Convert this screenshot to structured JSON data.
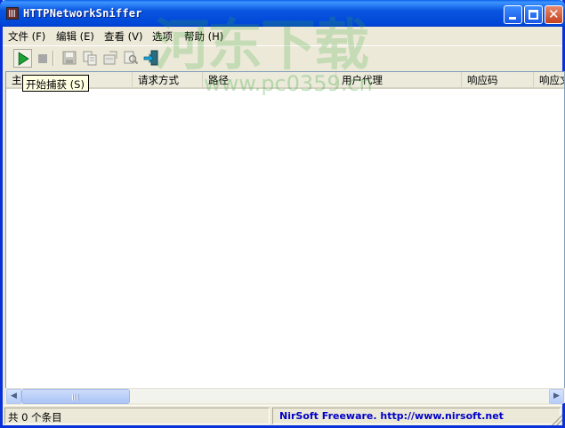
{
  "window": {
    "title": "HTTPNetworkSniffer",
    "icons": {
      "app": "app-network-icon",
      "minimize": "minimize-icon",
      "maximize": "maximize-icon",
      "close": "close-icon"
    },
    "accent": "#0a55e0"
  },
  "menubar": {
    "items": [
      {
        "label": "文件 (F)"
      },
      {
        "label": "编辑 (E)"
      },
      {
        "label": "查看 (V)"
      },
      {
        "label": "选项"
      },
      {
        "label": "帮助 (H)"
      }
    ]
  },
  "toolbar": {
    "buttons": [
      {
        "name": "start-capture",
        "icon": "play-icon",
        "enabled": true
      },
      {
        "name": "stop-capture",
        "icon": "stop-icon",
        "enabled": false
      },
      {
        "name": "save",
        "icon": "save-icon",
        "enabled": false
      },
      {
        "name": "copy",
        "icon": "copy-icon",
        "enabled": false
      },
      {
        "name": "properties",
        "icon": "properties-icon",
        "enabled": false
      },
      {
        "name": "find",
        "icon": "find-icon",
        "enabled": false
      },
      {
        "name": "exit",
        "icon": "exit-icon",
        "enabled": true
      }
    ],
    "tooltip": "开始捕获 (S)"
  },
  "listview": {
    "columns": [
      {
        "label": "主"
      },
      {
        "label": "请求方式"
      },
      {
        "label": "路径"
      },
      {
        "label": "用户代理"
      },
      {
        "label": "响应码"
      },
      {
        "label": "响应文"
      }
    ],
    "rows": []
  },
  "watermark": {
    "logo_text": "河东下载",
    "url": "www.pc0359.cn"
  },
  "statusbar": {
    "count_text": "共 0 个条目",
    "credit_prefix": "NirSoft Freeware.",
    "credit_link": "http://www.nirsoft.net"
  }
}
